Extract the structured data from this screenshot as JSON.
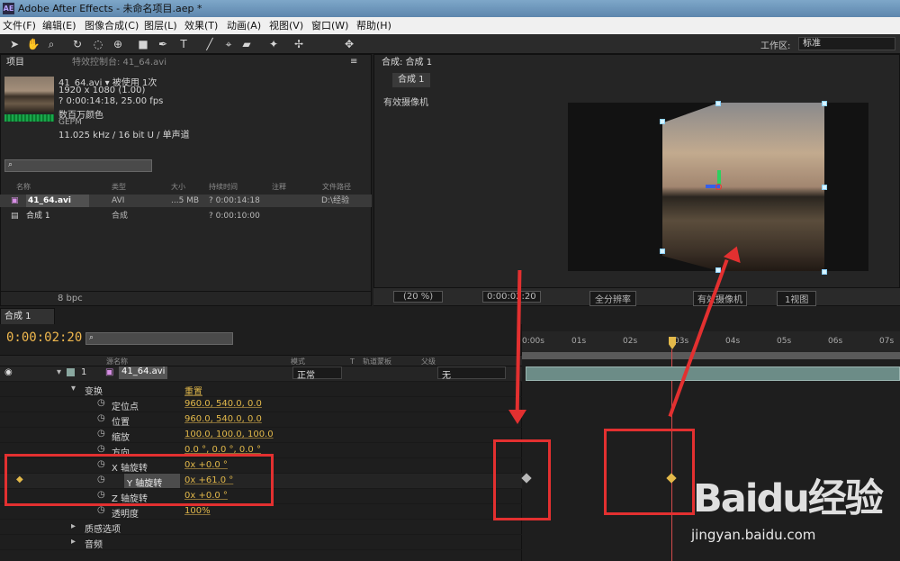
{
  "window": {
    "title": "Adobe After Effects - 未命名项目.aep *",
    "icon": "AE"
  },
  "menu": [
    "文件(F)",
    "编辑(E)",
    "图像合成(C)",
    "图层(L)",
    "效果(T)",
    "动画(A)",
    "视图(V)",
    "窗口(W)",
    "帮助(H)"
  ],
  "toolbar": {
    "workspace_label": "工作区:",
    "workspace_value": "标准"
  },
  "project": {
    "tab": "项目",
    "fx_tab": "特效控制台: 41_64.avi",
    "file_name": "41_64.avi ▾",
    "used": "被使用 1次",
    "resolution": "1920 x 1080 (1.00)",
    "duration": "? 0:00:14:18, 25.00 fps",
    "colors": "数百万颜色",
    "codec": "GEPM",
    "audio": "11.025 kHz / 16 bit U / 单声道",
    "search_icon": "search-icon",
    "columns": [
      "名称",
      "类型",
      "大小",
      "持续时间",
      "注释",
      "文件路径"
    ],
    "rows": [
      {
        "name": "41_64.avi",
        "type": "AVI",
        "size": "...5 MB",
        "duration": "? 0:00:14:18",
        "path": "D:\\经验"
      },
      {
        "name": "合成 1",
        "type": "合成",
        "size": "",
        "duration": "? 0:00:10:00",
        "path": ""
      }
    ],
    "bpc": "8 bpc"
  },
  "composition": {
    "tab": "合成: 合成 1",
    "subtab": "合成 1",
    "camera_label": "有效摄像机",
    "zoom": "(20 %)",
    "time": "0:00:02:20",
    "resolution": "全分辨率",
    "view_camera": "有效摄像机",
    "views": "1视图"
  },
  "timeline": {
    "tab": "合成 1",
    "time": "0:00:02:20",
    "columns": [
      "源名称",
      "模式",
      "T",
      "轨道蒙板",
      "父级"
    ],
    "ruler": [
      "0:00s",
      "01s",
      "02s",
      "03s",
      "04s",
      "05s",
      "06s",
      "07s"
    ],
    "layer": {
      "index": "1",
      "name": "41_64.avi",
      "mode": "正常",
      "parent": "无"
    },
    "transform": "变换",
    "reset": "重置",
    "properties": [
      {
        "name": "定位点",
        "value": "960.0, 540.0, 0.0"
      },
      {
        "name": "位置",
        "value": "960.0, 540.0, 0.0"
      },
      {
        "name": "缩放",
        "value": "100.0, 100.0, 100.0"
      },
      {
        "name": "方向",
        "value": "0.0 °, 0.0 °, 0.0 °"
      },
      {
        "name": "X 轴旋转",
        "value": "0x +0.0 °"
      },
      {
        "name": "Y 轴旋转",
        "value": "0x +61.0 °"
      },
      {
        "name": "Z 轴旋转",
        "value": "0x +0.0 °"
      },
      {
        "name": "透明度",
        "value": "100%"
      }
    ],
    "sections": [
      "质感选项",
      "音频"
    ]
  },
  "watermark": {
    "text": "Baidu经验",
    "sub": "jingyan.baidu.com"
  }
}
